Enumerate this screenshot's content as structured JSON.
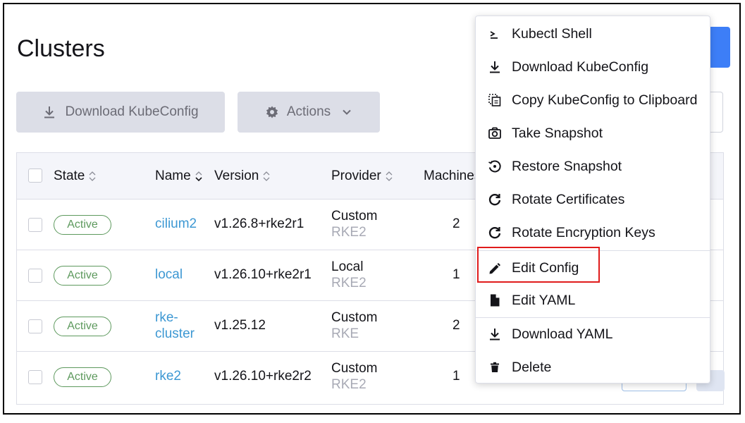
{
  "page": {
    "title": "Clusters"
  },
  "toolbar": {
    "download_label": "Download KubeConfig",
    "actions_label": "Actions"
  },
  "table": {
    "columns": [
      "State",
      "Name",
      "Version",
      "Provider",
      "Machines"
    ],
    "rows": [
      {
        "state": "Active",
        "name": "cilium2",
        "version": "v1.26.8+rke2r1",
        "provider": "Custom",
        "provider_sub": "RKE2",
        "machines": "2"
      },
      {
        "state": "Active",
        "name": "local",
        "version": "v1.26.10+rke2r1",
        "provider": "Local",
        "provider_sub": "RKE2",
        "machines": "1"
      },
      {
        "state": "Active",
        "name_line1": "rke-",
        "name_line2": "cluster",
        "version": "v1.25.12",
        "provider": "Custom",
        "provider_sub": "RKE",
        "machines": "2"
      },
      {
        "state": "Active",
        "name": "rke2",
        "version": "v1.26.10+rke2r2",
        "provider": "Custom",
        "provider_sub": "RKE2",
        "machines": "1"
      }
    ]
  },
  "menu": {
    "items": [
      {
        "label": "Kubectl Shell",
        "icon": "terminal-icon"
      },
      {
        "label": "Download KubeConfig",
        "icon": "download-icon"
      },
      {
        "label": "Copy KubeConfig to Clipboard",
        "icon": "copy-icon"
      },
      {
        "label": "Take Snapshot",
        "icon": "camera-icon"
      },
      {
        "label": "Restore Snapshot",
        "icon": "restore-icon"
      },
      {
        "label": "Rotate Certificates",
        "icon": "rotate-icon"
      },
      {
        "label": "Rotate Encryption Keys",
        "icon": "rotate-icon"
      },
      {
        "label": "Edit Config",
        "icon": "pencil-icon"
      },
      {
        "label": "Edit YAML",
        "icon": "file-icon"
      },
      {
        "label": "Download YAML",
        "icon": "download-icon"
      },
      {
        "label": "Delete",
        "icon": "trash-icon"
      }
    ]
  },
  "colors": {
    "accent": "#3d7ef7",
    "link": "#3d98d3",
    "active": "#5d995d",
    "highlight": "#e01c1c"
  }
}
